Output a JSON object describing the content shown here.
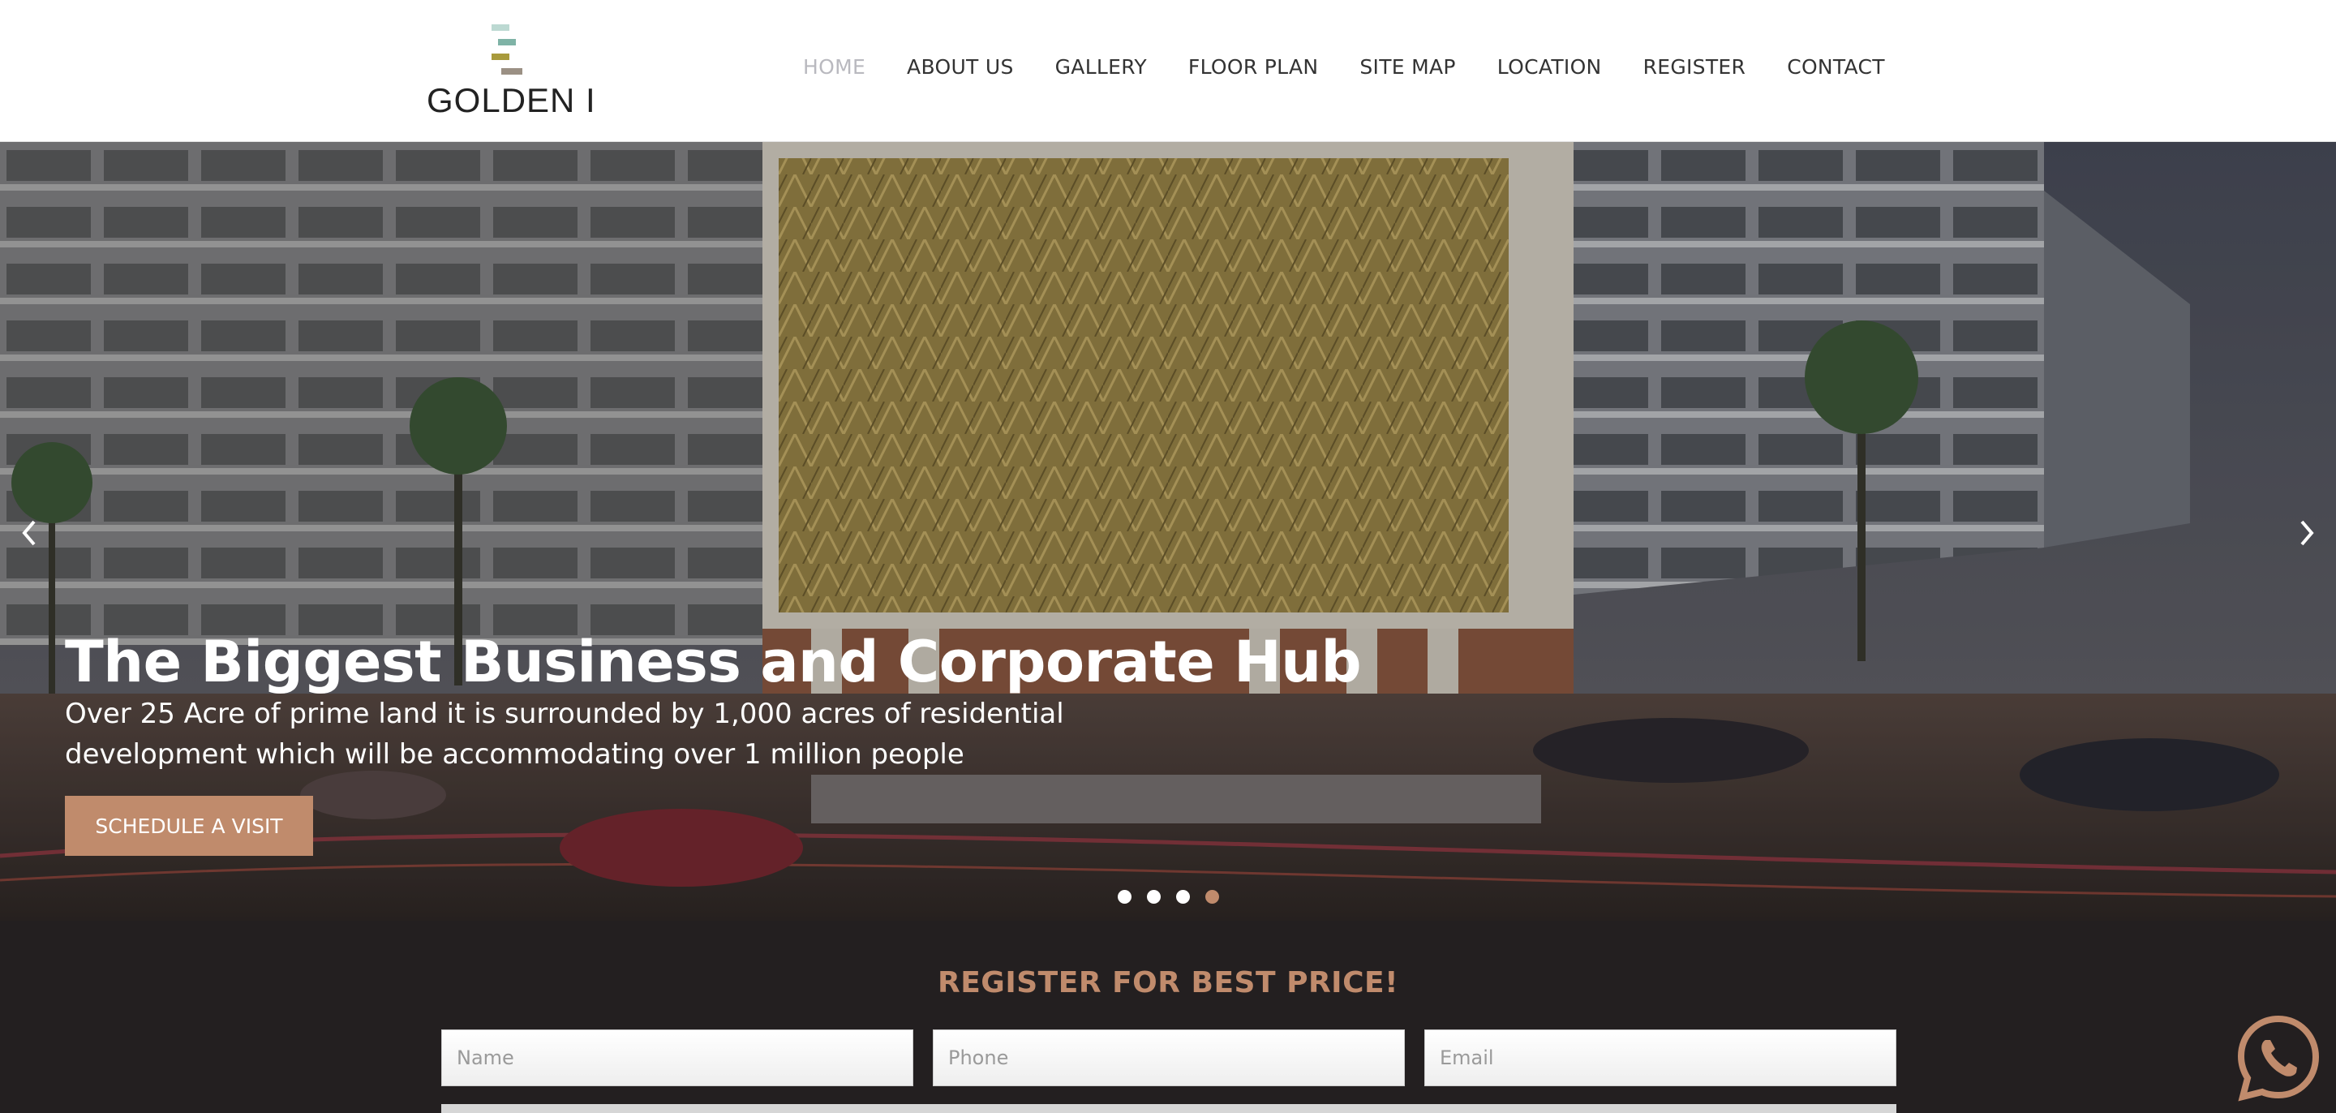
{
  "brand": {
    "name": "GOLDEN I",
    "logo_bar_colors": [
      "#bcd9d2",
      "#7fb3a6",
      "#a89a3c",
      "#9b9084"
    ]
  },
  "nav": {
    "items": [
      {
        "label": "HOME",
        "active": true
      },
      {
        "label": "ABOUT US"
      },
      {
        "label": "GALLERY"
      },
      {
        "label": "FLOOR PLAN"
      },
      {
        "label": "SITE MAP"
      },
      {
        "label": "LOCATION"
      },
      {
        "label": "REGISTER"
      },
      {
        "label": "CONTACT"
      }
    ]
  },
  "hero": {
    "title": "The Biggest Business and Corporate Hub",
    "description": "Over 25 Acre of prime land it is surrounded by 1,000 acres of residential development which will be accommodating over 1 million people",
    "cta_label": "SCHEDULE A VISIT",
    "slides_total": 4,
    "active_slide": 4
  },
  "register": {
    "title": "REGISTER FOR BEST PRICE!",
    "name_placeholder": "Name",
    "phone_placeholder": "Phone",
    "email_placeholder": "Email"
  },
  "colors": {
    "accent": "#c08b6c",
    "band_bg": "#231f20",
    "nav_active": "#b9b9bf"
  },
  "icons": {
    "prev": "chevron-left-icon",
    "next": "chevron-right-icon",
    "chat": "whatsapp-icon"
  }
}
